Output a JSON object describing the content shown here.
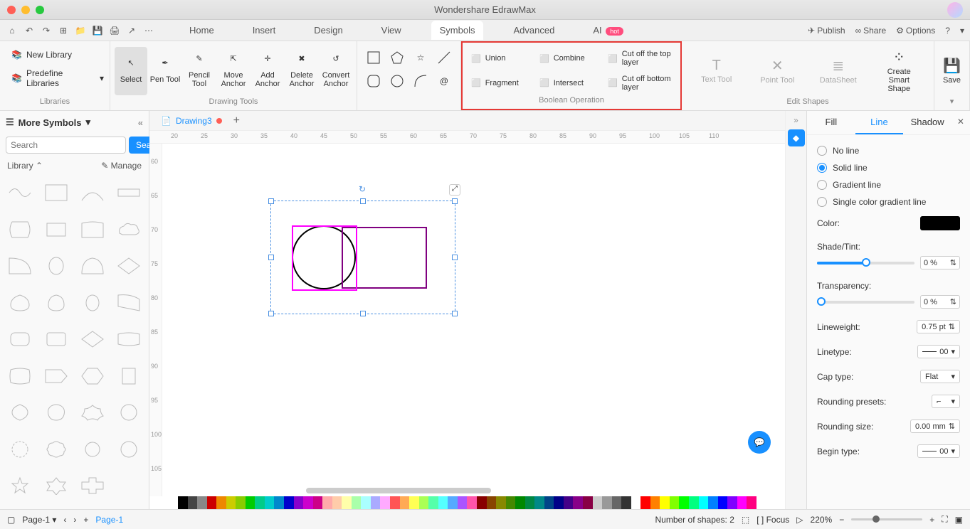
{
  "app_title": "Wondershare EdrawMax",
  "menu": {
    "home": "Home",
    "insert": "Insert",
    "design": "Design",
    "view": "View",
    "symbols": "Symbols",
    "advanced": "Advanced",
    "ai": "AI",
    "hot": "hot"
  },
  "top_actions": {
    "publish": "Publish",
    "share": "Share",
    "options": "Options"
  },
  "libraries": {
    "new": "New Library",
    "predefine": "Predefine Libraries",
    "label": "Libraries"
  },
  "tools": {
    "select": "Select",
    "pen": "Pen Tool",
    "pencil": "Pencil Tool",
    "move": "Move Anchor",
    "add": "Add Anchor",
    "delete": "Delete Anchor",
    "convert": "Convert Anchor",
    "group_label": "Drawing Tools"
  },
  "boolean": {
    "label": "Boolean Operation",
    "union": "Union",
    "combine": "Combine",
    "cutoff_top": "Cut off the top layer",
    "fragment": "Fragment",
    "intersect": "Intersect",
    "cutoff_bottom": "Cut off bottom layer"
  },
  "edit_shapes": {
    "label": "Edit Shapes",
    "text": "Text Tool",
    "point": "Point Tool",
    "datasheet": "DataSheet",
    "smart": "Create Smart Shape"
  },
  "save": "Save",
  "more_symbols": "More Symbols",
  "search": {
    "placeholder": "Search",
    "btn": "Search"
  },
  "library_hdr": {
    "library": "Library",
    "manage": "Manage"
  },
  "doc": {
    "name": "Drawing3",
    "add": "+"
  },
  "right_panel": {
    "tabs": {
      "fill": "Fill",
      "line": "Line",
      "shadow": "Shadow"
    },
    "line_type": {
      "none": "No line",
      "solid": "Solid line",
      "gradient": "Gradient line",
      "single": "Single color gradient line"
    },
    "color": "Color:",
    "shade": "Shade/Tint:",
    "shade_val": "0 %",
    "transparency": "Transparency:",
    "trans_val": "0 %",
    "lineweight": "Lineweight:",
    "lw_val": "0.75 pt",
    "linetype": "Linetype:",
    "lt_val": "00",
    "captype": "Cap type:",
    "cap_val": "Flat",
    "rounding_presets": "Rounding presets:",
    "rounding_size": "Rounding size:",
    "rs_val": "0.00 mm",
    "begin_type": "Begin type:",
    "bt_val": "00"
  },
  "status": {
    "page": "Page-1",
    "page_label": "Page-1",
    "shapes": "Number of shapes: 2",
    "focus": "Focus",
    "zoom": "220%"
  },
  "ruler_h": [
    20,
    25,
    30,
    35,
    40,
    45,
    50,
    55,
    60,
    65,
    70,
    75,
    80,
    85,
    90,
    95,
    100,
    105,
    110
  ],
  "ruler_v": [
    60,
    65,
    70,
    75,
    80,
    85,
    90,
    95,
    100,
    105
  ]
}
